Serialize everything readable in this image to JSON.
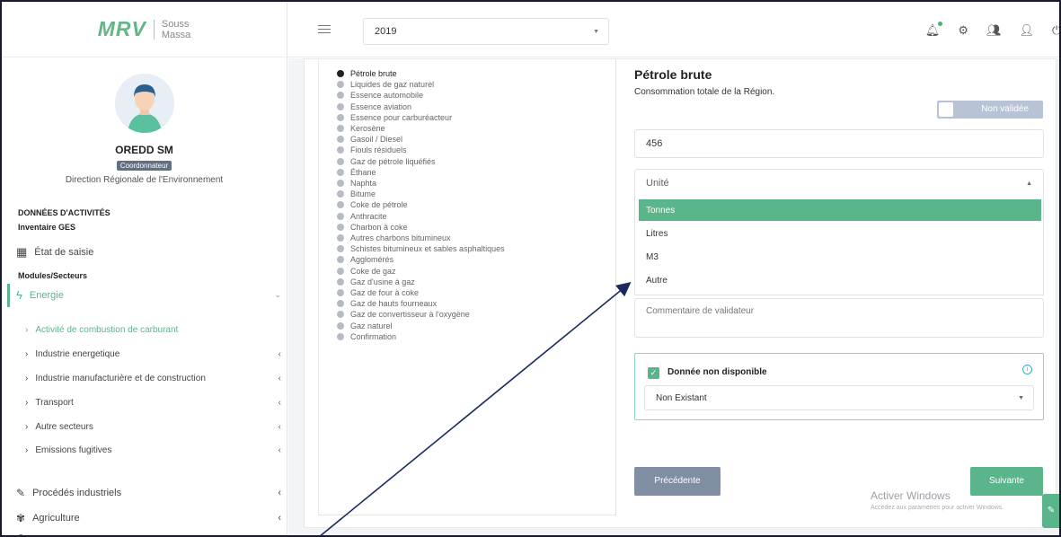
{
  "logo": {
    "main": "MRV",
    "sub1": "Souss",
    "sub2": "Massa"
  },
  "profile": {
    "name": "OREDD SM",
    "role": "Coordonnateur",
    "org": "Direction Régionale de l'Environnement"
  },
  "sidebar": {
    "section_activities": "DONNÉES D'ACTIVITÉS",
    "section_inventory": "Inventaire GES",
    "etat": "État de saisie",
    "section_modules": "Modules/Secteurs",
    "energie": "Energie",
    "sub_items": [
      {
        "label": "Activité de combustion de carburant",
        "caret": ""
      },
      {
        "label": "Industrie energetique",
        "caret": "‹"
      },
      {
        "label": "Industrie manufacturière et de construction",
        "caret": "‹"
      },
      {
        "label": "Transport",
        "caret": "‹"
      },
      {
        "label": "Autre secteurs",
        "caret": "‹"
      },
      {
        "label": "Emissions fugitives",
        "caret": "‹"
      }
    ],
    "procedes": "Procédés industriels",
    "agriculture": "Agriculture"
  },
  "topbar": {
    "year": "2019"
  },
  "products": [
    "Pétrole brute",
    "Liquides de gaz naturel",
    "Essence automobile",
    "Essence aviation",
    "Essence pour carburéacteur",
    "Kerosène",
    "Gasoil / Diesel",
    "Fiouls résiduels",
    "Gaz de pétrole liquéfiés",
    "Éthane",
    "Naphta",
    "Bitume",
    "Coke de pétrole",
    "Anthracite",
    "Charbon à coke",
    "Autres charbons bitumineux",
    "Schistes bitumineux et sables asphaltiques",
    "Agglomérés",
    "Coke de gaz",
    "Gaz d'usine à gaz",
    "Gaz de four à coke",
    "Gaz de hauts fourneaux",
    "Gaz de convertisseur à l'oxygène",
    "Gaz naturel",
    "Confirmation"
  ],
  "form": {
    "title": "Pétrole brute",
    "subtitle": "Consommation totale de la Région.",
    "toggle_label": "Non validée",
    "value": "456",
    "unit_placeholder": "Unité",
    "unit_options": [
      "Tonnes",
      "Litres",
      "M3",
      "Autre"
    ],
    "comment_placeholder": "Commentaire de validateur",
    "nd_label": "Donnée non disponible",
    "nd_select": "Non Existant",
    "prev": "Précédente",
    "next": "Suivante"
  },
  "watermark": {
    "line1": "Activer Windows",
    "line2": "Accédez aux paramètres pour activer Windows."
  }
}
